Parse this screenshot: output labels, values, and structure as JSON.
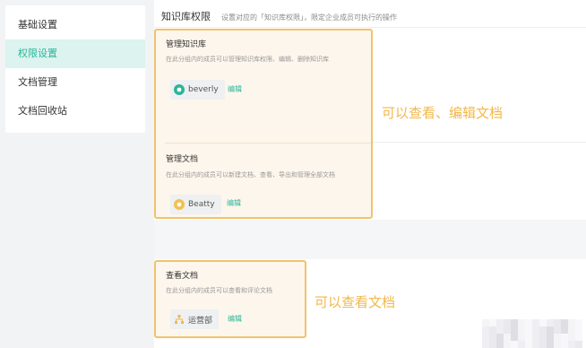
{
  "sidebar": {
    "items": [
      {
        "label": "基础设置",
        "active": false
      },
      {
        "label": "权限设置",
        "active": true
      },
      {
        "label": "文档管理",
        "active": false
      },
      {
        "label": "文档回收站",
        "active": false
      }
    ]
  },
  "main": {
    "title": "知识库权限",
    "description": "设置对应的「知识库权限」，限定企业成员可执行的操作",
    "manage_kb": {
      "title": "管理知识库",
      "description": "在此分组内的成员可以管理知识库权限、编辑、删除知识库",
      "member": "beverly",
      "edit_label": "编辑"
    },
    "manage_doc": {
      "title": "管理文档",
      "description": "在此分组内的成员可以新建文档、查看、导出和管理全部文档",
      "member": "Beatty",
      "edit_label": "编辑"
    },
    "view_doc": {
      "title": "查看文档",
      "description": "在此分组内的成员可以查看和评论文档",
      "member": "运营部",
      "edit_label": "编辑"
    }
  },
  "annotations": {
    "edit_view": "可以查看、编辑文档",
    "view_only": "可以查看文档"
  },
  "colors": {
    "accent": "#2bb59a",
    "highlight_border": "#f0c36d",
    "annotation": "#f2b84b"
  },
  "icons": {
    "beverly_avatar": "circle-face-icon",
    "beatty_avatar": "circle-face-icon",
    "dept_icon": "org-tree-icon"
  }
}
